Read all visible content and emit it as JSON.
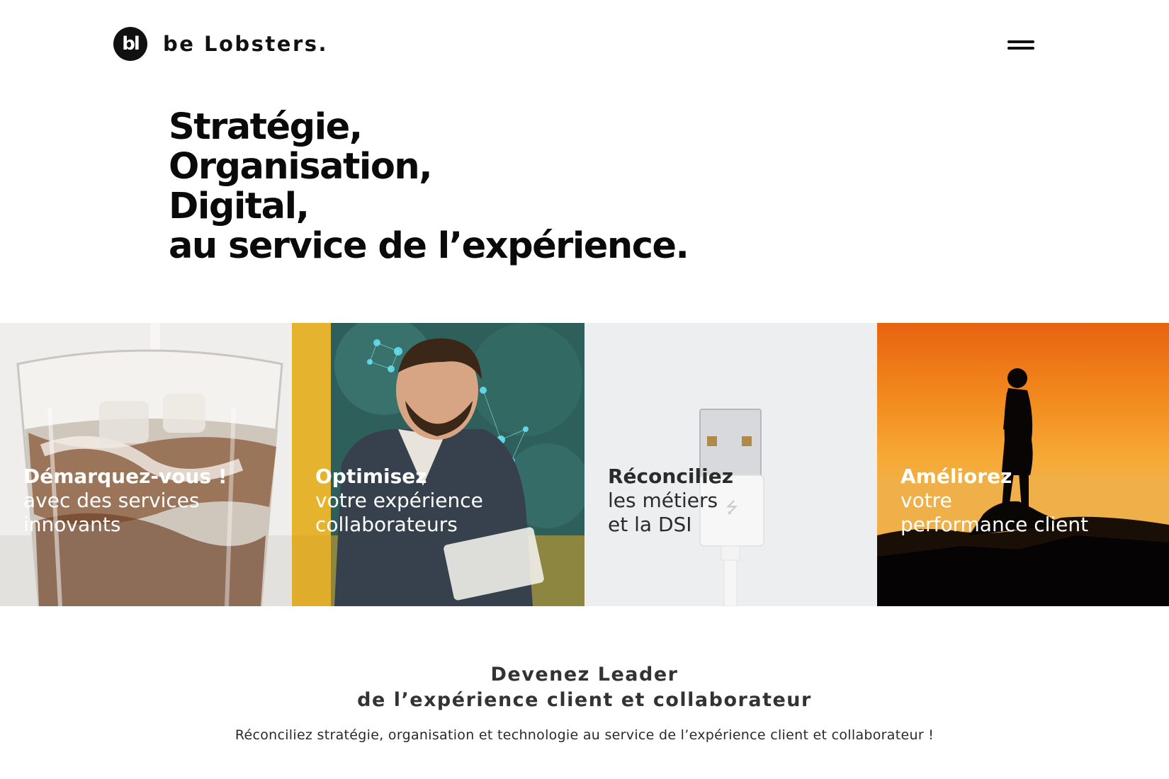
{
  "header": {
    "logo_mark": "bl",
    "logo_text": "be Lobsters.",
    "menu_icon": "hamburger-icon"
  },
  "hero": {
    "lines": [
      "Stratégie,",
      "Organisation,",
      "Digital,",
      "au service de l’expérience."
    ]
  },
  "tiles": [
    {
      "strong": "Démarquez-vous !",
      "line1": "avec des services",
      "line2": "innovants",
      "image": "iced-coffee-glass-image"
    },
    {
      "strong": "Optimisez",
      "line1": "votre expérience",
      "line2": "collaborateurs",
      "image": "smiling-man-at-desk-image"
    },
    {
      "strong": "Réconciliez",
      "line1": "les métiers",
      "line2": "et la DSI",
      "image": "usb-cable-image"
    },
    {
      "strong": "Améliorez",
      "line1": "votre",
      "line2": "performance client",
      "image": "silhouette-sunset-image"
    }
  ],
  "section": {
    "title_line1": "Devenez Leader",
    "title_line2": "de l’expérience client et collaborateur",
    "subtitle": "Réconciliez stratégie, organisation et technologie au service de l’expérience client et collaborateur !"
  }
}
